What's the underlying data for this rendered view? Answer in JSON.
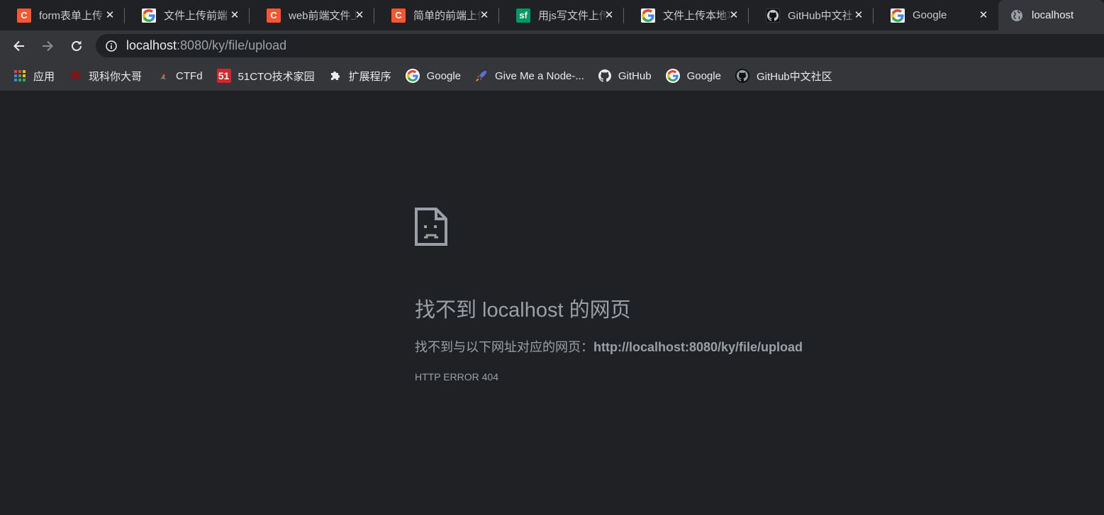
{
  "tabs": [
    {
      "title": "form表单上传",
      "favicon": "csdn-icon",
      "glyph": "C"
    },
    {
      "title": "文件上传前端",
      "favicon": "google-icon",
      "glyph": "G"
    },
    {
      "title": "web前端文件上",
      "favicon": "csdn-icon",
      "glyph": "C"
    },
    {
      "title": "简单的前端上传",
      "favicon": "csdn-icon",
      "glyph": "C"
    },
    {
      "title": "用js写文件上传",
      "favicon": "segmentfault-icon",
      "glyph": "sf"
    },
    {
      "title": "文件上传本地功",
      "favicon": "google-icon",
      "glyph": "G"
    },
    {
      "title": "GitHub中文社",
      "favicon": "github-icon",
      "glyph": ""
    },
    {
      "title": "Google",
      "favicon": "google-icon",
      "glyph": "G"
    },
    {
      "title": "localhost",
      "favicon": "globe-icon",
      "glyph": "",
      "active": true
    }
  ],
  "omnibox": {
    "host": "localhost",
    "rest": ":8080/ky/file/upload"
  },
  "bookmarks": [
    {
      "label": "应用",
      "icon": "apps-grid-icon"
    },
    {
      "label": "现科你大哥",
      "icon": "spider-icon"
    },
    {
      "label": "CTFd",
      "icon": "ctfd-icon"
    },
    {
      "label": "51CTO技术家园",
      "icon": "51cto-icon"
    },
    {
      "label": "扩展程序",
      "icon": "puzzle-icon"
    },
    {
      "label": "Google",
      "icon": "google-icon"
    },
    {
      "label": "Give Me a Node-...",
      "icon": "rocket-icon"
    },
    {
      "label": "GitHub",
      "icon": "github-icon"
    },
    {
      "label": "Google",
      "icon": "google-icon"
    },
    {
      "label": "GitHub中文社区",
      "icon": "github-icon"
    }
  ],
  "error": {
    "title": "找不到 localhost 的网页",
    "desc_prefix": "找不到与以下网址对应的网页：",
    "desc_url": "http://localhost:8080/ky/file/upload",
    "code": "HTTP ERROR 404"
  },
  "colors": {
    "background": "#202124",
    "toolbar": "#35363a",
    "csdn": "#fc5531",
    "segmentfault": "#009a61",
    "muted_text": "#9aa0a6"
  }
}
